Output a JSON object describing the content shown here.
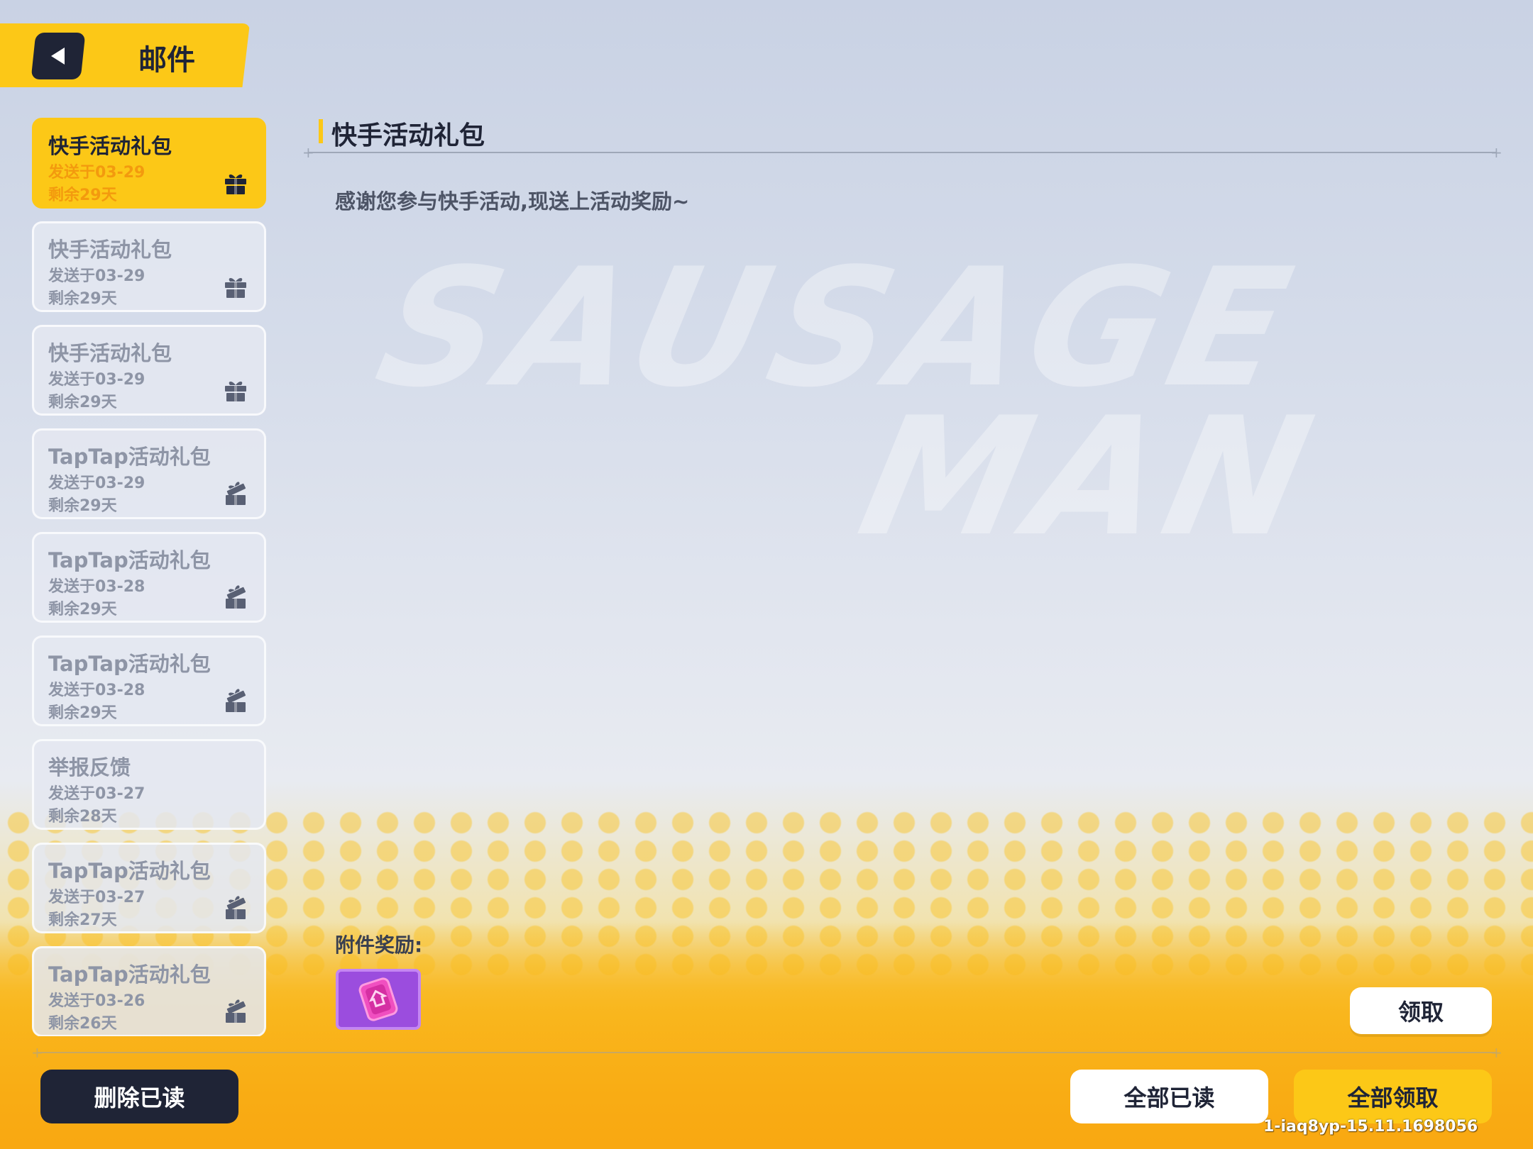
{
  "header": {
    "title": "邮件",
    "back_icon": "back-arrow-icon"
  },
  "mail_list": [
    {
      "title": "快手活动礼包",
      "date": "发送于03-29",
      "remaining": "剩余29天",
      "icon": "gift-box-icon",
      "active": true
    },
    {
      "title": "快手活动礼包",
      "date": "发送于03-29",
      "remaining": "剩余29天",
      "icon": "gift-box-icon",
      "active": false
    },
    {
      "title": "快手活动礼包",
      "date": "发送于03-29",
      "remaining": "剩余29天",
      "icon": "gift-box-icon",
      "active": false
    },
    {
      "title": "TapTap活动礼包",
      "date": "发送于03-29",
      "remaining": "剩余29天",
      "icon": "gift-open-icon",
      "active": false
    },
    {
      "title": "TapTap活动礼包",
      "date": "发送于03-28",
      "remaining": "剩余29天",
      "icon": "gift-open-icon",
      "active": false
    },
    {
      "title": "TapTap活动礼包",
      "date": "发送于03-28",
      "remaining": "剩余29天",
      "icon": "gift-open-icon",
      "active": false
    },
    {
      "title": "举报反馈",
      "date": "发送于03-27",
      "remaining": "剩余28天",
      "icon": "",
      "active": false
    },
    {
      "title": "TapTap活动礼包",
      "date": "发送于03-27",
      "remaining": "剩余27天",
      "icon": "gift-open-icon",
      "active": false
    },
    {
      "title": "TapTap活动礼包",
      "date": "发送于03-26",
      "remaining": "剩余26天",
      "icon": "gift-open-icon",
      "active": false
    }
  ],
  "content": {
    "title": "快手活动礼包",
    "body": "感谢您参与快手活动,现送上活动奖励~",
    "attachment_label": "附件奖励:",
    "attachment_icon": "purple-card-icon"
  },
  "buttons": {
    "claim": "领取",
    "delete_read": "删除已读",
    "read_all": "全部已读",
    "claim_all": "全部领取"
  },
  "version": "1-iaq8yp-15.11.1698056",
  "colors": {
    "accent": "#fcc817",
    "dark": "#1f2436",
    "date_active": "#f39a0e",
    "attachment": "#9b4dde"
  }
}
